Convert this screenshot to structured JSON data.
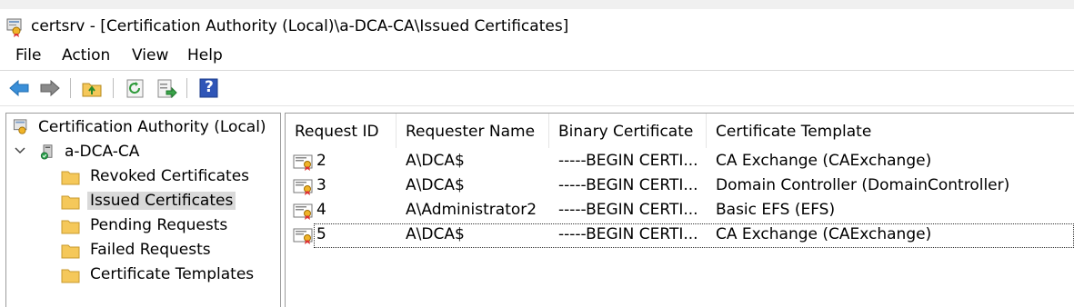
{
  "window": {
    "title": "certsrv - [Certification Authority (Local)\\a-DCA-CA\\Issued Certificates]",
    "app_icon": "certsrv-icon"
  },
  "menu": [
    "File",
    "Action",
    "View",
    "Help"
  ],
  "toolbar": {
    "buttons": [
      "back-arrow-icon",
      "forward-arrow-icon",
      "up-folder-icon",
      "refresh-icon",
      "export-list-icon",
      "help-icon"
    ],
    "help_glyph": "?"
  },
  "tree": {
    "root": "Certification Authority (Local)",
    "ca": "a-DCA-CA",
    "folders": [
      "Revoked Certificates",
      "Issued Certificates",
      "Pending Requests",
      "Failed Requests",
      "Certificate Templates"
    ],
    "selected": "Issued Certificates"
  },
  "list": {
    "columns": [
      "Request ID",
      "Requester Name",
      "Binary Certificate",
      "Certificate Template"
    ],
    "rows": [
      {
        "id": "2",
        "requester": "A\\DCA$",
        "binary": "-----BEGIN CERTI...",
        "template": "CA Exchange (CAExchange)"
      },
      {
        "id": "3",
        "requester": "A\\DCA$",
        "binary": "-----BEGIN CERTI...",
        "template": "Domain Controller (DomainController)"
      },
      {
        "id": "4",
        "requester": "A\\Administrator2",
        "binary": "-----BEGIN CERTI...",
        "template": "Basic EFS (EFS)"
      },
      {
        "id": "5",
        "requester": "A\\DCA$",
        "binary": "-----BEGIN CERTI...",
        "template": "CA Exchange (CAExchange)"
      }
    ]
  },
  "colors": {
    "selection": "#d9d9d9",
    "folder": "#f5c85a",
    "arrow": "#3b8fd8"
  }
}
